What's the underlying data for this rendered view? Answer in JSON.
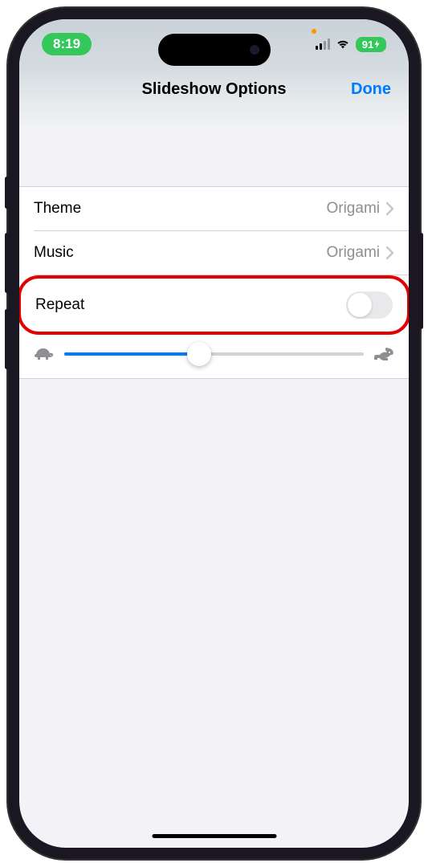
{
  "status": {
    "time": "8:19",
    "battery": "91"
  },
  "header": {
    "title": "Slideshow Options",
    "done": "Done"
  },
  "rows": {
    "theme": {
      "label": "Theme",
      "value": "Origami"
    },
    "music": {
      "label": "Music",
      "value": "Origami"
    },
    "repeat": {
      "label": "Repeat",
      "on": false
    }
  },
  "slider": {
    "position_percent": 45
  }
}
